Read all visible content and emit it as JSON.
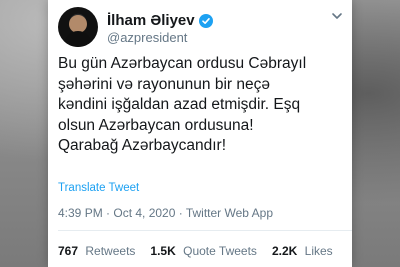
{
  "colors": {
    "link": "#1da1f2",
    "verified": "#1da1f2",
    "text": "#14171a",
    "muted": "#657786"
  },
  "tweet": {
    "author_name": "İlham Əliyev",
    "handle": "@azpresident",
    "verified": true,
    "text": "Bu gün Azərbaycan ordusu Cəbrayıl\nşəhərini  və rayonunun bir neçə\nkəndini işğaldan azad etmişdir. Eşq\nolsun Azərbaycan ordusuna!\nQarabağ Azərbaycandır!",
    "translate_label": "Translate Tweet",
    "meta": "4:39 PM · Oct 4, 2020 · Twitter Web App",
    "stats": {
      "retweets_count": "767",
      "retweets_label": "Retweets",
      "quotes_count": "1.5K",
      "quotes_label": "Quote Tweets",
      "likes_count": "2.2K",
      "likes_label": "Likes"
    }
  },
  "icons": {
    "more": "chevron-down-icon",
    "verified": "verified-badge-icon",
    "avatar": "profile-avatar"
  }
}
